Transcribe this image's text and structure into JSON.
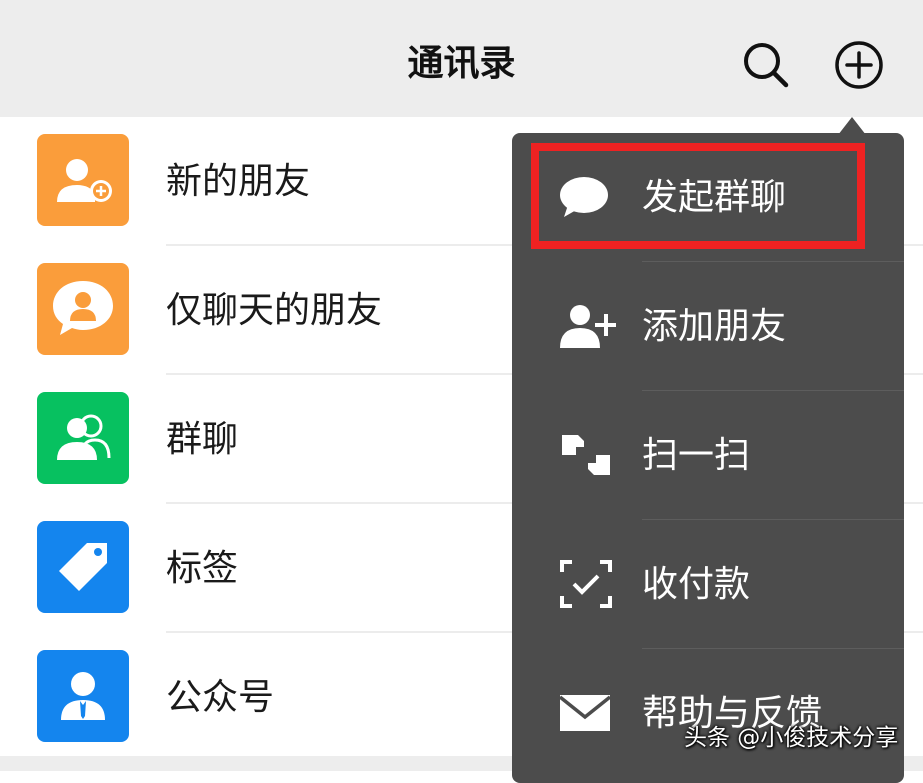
{
  "header": {
    "title": "通讯录",
    "search_icon": "search-icon",
    "add_icon": "plus-circle-icon"
  },
  "contacts": {
    "items": [
      {
        "label": "新的朋友",
        "icon": "add-friend-icon",
        "color": "#fa9d3b"
      },
      {
        "label": "仅聊天的朋友",
        "icon": "chat-only-friend-icon",
        "color": "#fa9d3b"
      },
      {
        "label": "群聊",
        "icon": "group-chat-icon",
        "color": "#07c160"
      },
      {
        "label": "标签",
        "icon": "tag-icon",
        "color": "#1485ee"
      },
      {
        "label": "公众号",
        "icon": "official-account-icon",
        "color": "#1485ee"
      }
    ]
  },
  "menu": {
    "items": [
      {
        "label": "发起群聊",
        "icon": "chat-bubble-icon",
        "highlighted": true
      },
      {
        "label": "添加朋友",
        "icon": "add-user-icon"
      },
      {
        "label": "扫一扫",
        "icon": "scan-icon"
      },
      {
        "label": "收付款",
        "icon": "money-scan-icon"
      },
      {
        "label": "帮助与反馈",
        "icon": "mail-icon"
      }
    ],
    "background": "#4c4c4c",
    "highlight_color": "#ee2222"
  },
  "watermark": "头条 @小俊技术分享"
}
